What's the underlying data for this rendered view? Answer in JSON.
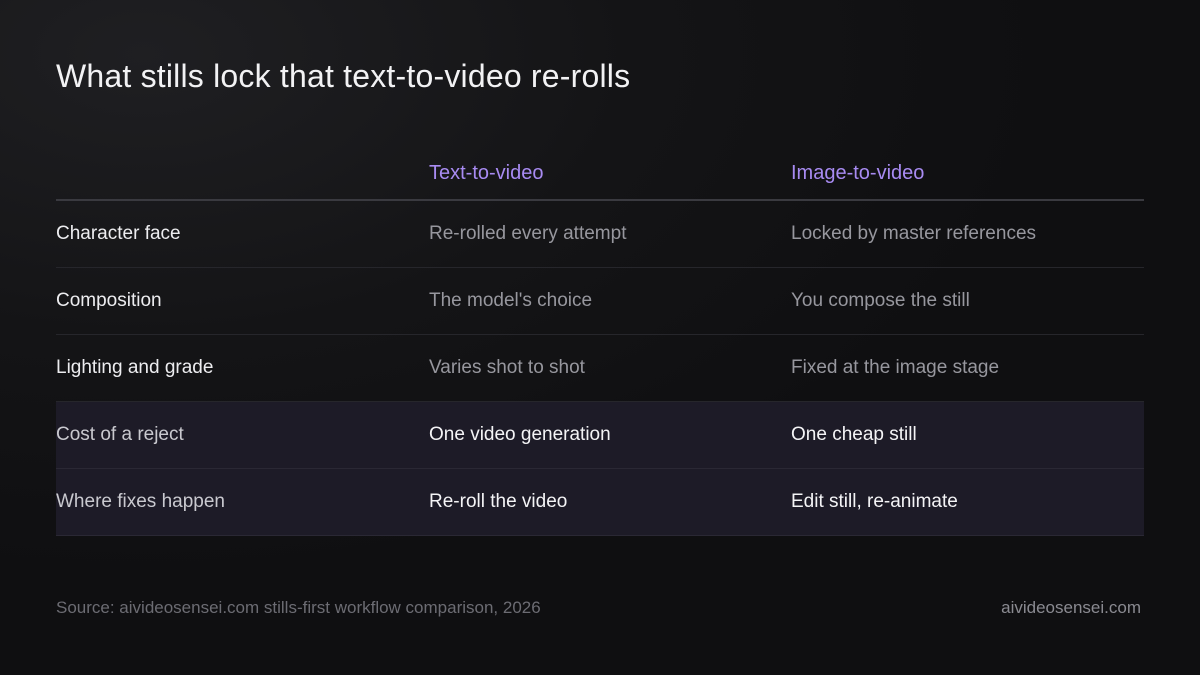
{
  "title": "What stills lock that text-to-video re-rolls",
  "table": {
    "headers": [
      "",
      "Text-to-video",
      "Image-to-video"
    ],
    "rows": [
      {
        "label": "Character face",
        "text_to_video": "Re-rolled every attempt",
        "image_to_video": "Locked by master references",
        "highlighted": false
      },
      {
        "label": "Composition",
        "text_to_video": "The model's choice",
        "image_to_video": "You compose the still",
        "highlighted": false
      },
      {
        "label": "Lighting and grade",
        "text_to_video": "Varies shot to shot",
        "image_to_video": "Fixed at the image stage",
        "highlighted": false
      },
      {
        "label": "Cost of a reject",
        "text_to_video": "One video generation",
        "image_to_video": "One cheap still",
        "highlighted": true
      },
      {
        "label": "Where fixes happen",
        "text_to_video": "Re-roll the video",
        "image_to_video": "Edit still, re-animate",
        "highlighted": true
      }
    ]
  },
  "footer": {
    "source": "Source: aivideosensei.com stills-first workflow comparison, 2026",
    "brand": "aivideosensei.com"
  },
  "colors": {
    "accent": "#a88bf2",
    "background": "#141416",
    "highlight_row": "#1d1b27"
  }
}
